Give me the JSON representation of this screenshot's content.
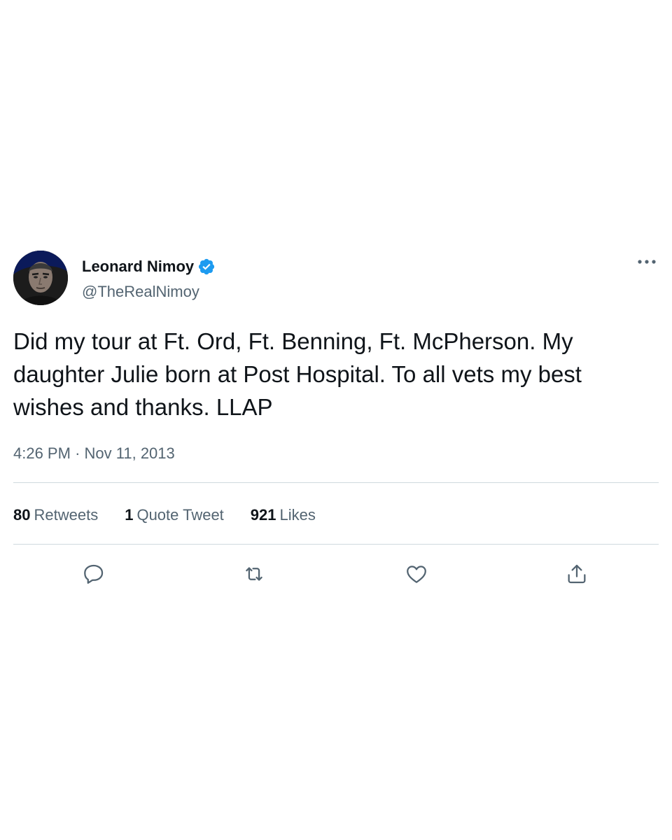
{
  "tweet": {
    "author": {
      "display_name": "Leonard Nimoy",
      "handle": "@TheRealNimoy",
      "verified": true
    },
    "text": "Did my tour at Ft. Ord, Ft. Benning, Ft. McPherson. My daughter Julie born at Post Hospital. To all vets my best wishes and thanks. LLAP",
    "time": "4:26 PM",
    "separator": "·",
    "date": "Nov 11, 2013",
    "stats": {
      "retweets": {
        "count": "80",
        "label": "Retweets"
      },
      "quote_tweets": {
        "count": "1",
        "label": "Quote Tweet"
      },
      "likes": {
        "count": "921",
        "label": "Likes"
      }
    },
    "actions": [
      "reply-icon",
      "retweet-icon",
      "like-icon",
      "share-icon"
    ]
  },
  "colors": {
    "text": "#0f1419",
    "secondary": "#536471",
    "divider": "#cfd9de",
    "verified": "#1d9bf0",
    "background": "#ffffff"
  }
}
